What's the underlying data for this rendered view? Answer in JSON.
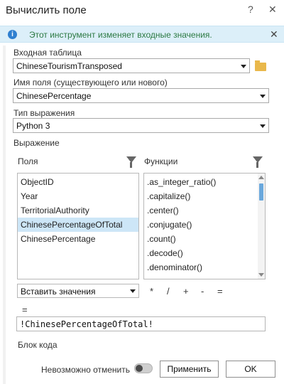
{
  "window": {
    "title": "Вычислить поле",
    "help_glyph": "?",
    "close_glyph": "✕"
  },
  "info": {
    "icon_glyph": "i",
    "message": "Этот инструмент изменяет входные значения.",
    "dismiss_glyph": "✕"
  },
  "form": {
    "input_table_label": "Входная таблица",
    "input_table_value": "ChineseTourismTransposed",
    "field_name_label": "Имя поля (существующего или нового)",
    "field_name_value": "ChinesePercentage",
    "expression_type_label": "Тип выражения",
    "expression_type_value": "Python 3",
    "expression_label": "Выражение",
    "fields_label": "Поля",
    "functions_label": "Функции",
    "fields": [
      "ObjectID",
      "Year",
      "TerritorialAuthority",
      "ChinesePercentageOfTotal",
      "ChinesePercentage"
    ],
    "selected_field_index": 3,
    "functions": [
      ".as_integer_ratio()",
      ".capitalize()",
      ".center()",
      ".conjugate()",
      ".count()",
      ".decode()",
      ".denominator()"
    ],
    "insert_values_label": "Вставить значения",
    "operators": [
      "*",
      "/",
      "+",
      "-",
      "="
    ],
    "assign_label": "=",
    "expression_value": "!ChinesePercentageOfTotal!",
    "code_block_label": "Блок кода"
  },
  "footer": {
    "undo_label": "Невозможно отменить",
    "undo_enabled": false,
    "apply_label": "Применить",
    "ok_label": "OK"
  },
  "colors": {
    "info_background": "#dceff9",
    "info_text": "#2d7a43",
    "selection": "#cde6f7"
  }
}
